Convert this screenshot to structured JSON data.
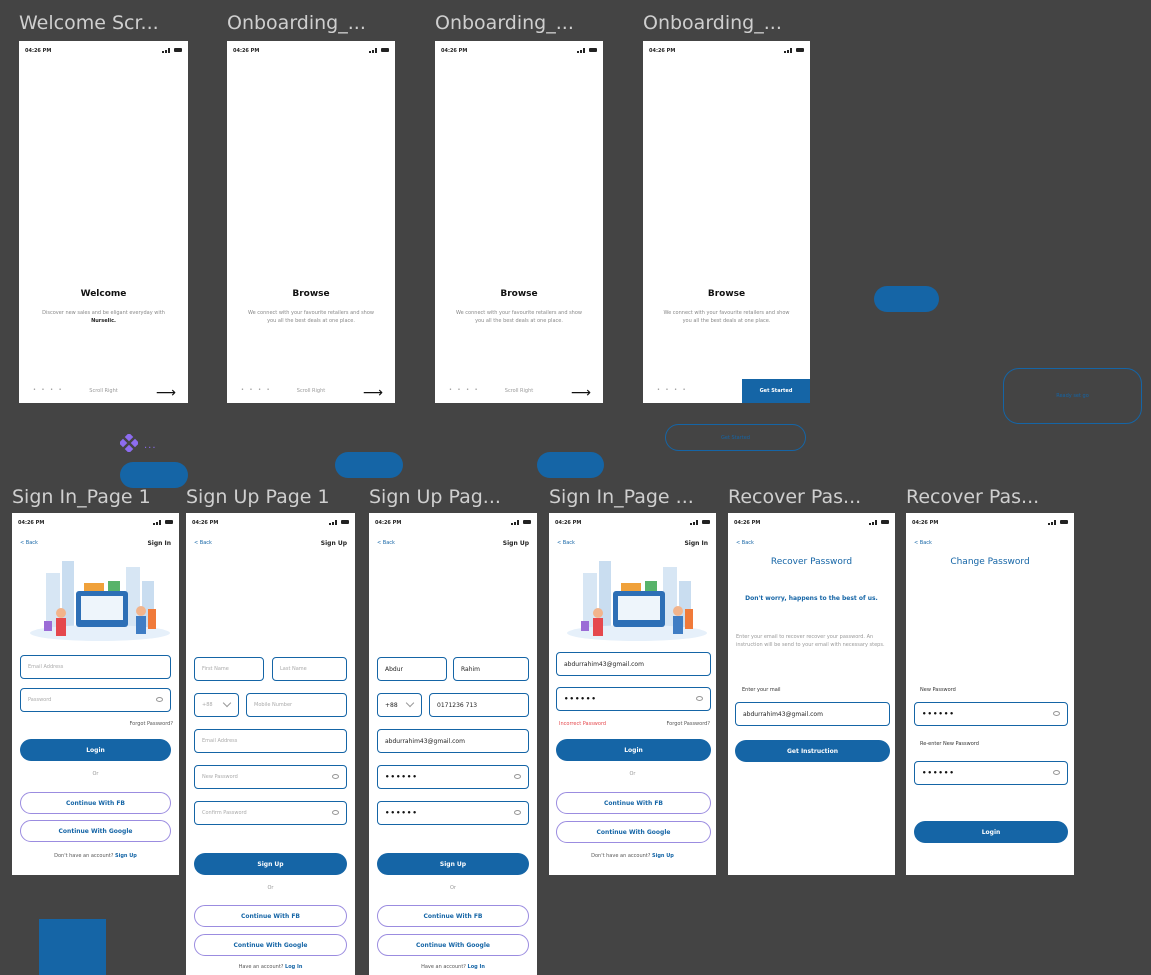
{
  "colors": {
    "canvas": "#444444",
    "primary": "#1565a6",
    "outline": "#9b8ce0",
    "component": "#8d6cf0"
  },
  "icons": {
    "signal": "signal-icon",
    "wifi": "wifi-icon",
    "battery": "battery-icon",
    "arrow": "arrow-right-icon",
    "eye": "eye-icon",
    "chevron": "chevron-down-icon",
    "component": "component-icon"
  },
  "frames": {
    "welcome": {
      "title": "Welcome Scr...",
      "time": "04:26 PM",
      "heading": "Welcome",
      "desc_a": "Discover new sales and be eligant everyday with ",
      "desc_brand": "Nurselic.",
      "dots": "• • • •",
      "scroll": "Scroll Right",
      "arrow": "⟶"
    },
    "onb1": {
      "title": "Onboarding_...",
      "time": "04:26 PM",
      "heading": "Browse",
      "desc": "We connect with your favourite retailers and show you all the best deals at one place.",
      "dots": "• • • •",
      "scroll": "Scroll Right",
      "arrow": "⟶"
    },
    "onb2": {
      "title": "Onboarding_...",
      "time": "04:26 PM",
      "heading": "Browse",
      "desc": "We connect with your favourite retailers and show you all the best deals at one place.",
      "dots": "• • • •",
      "scroll": "Scroll Right",
      "arrow": "⟶"
    },
    "onb3": {
      "title": "Onboarding_...",
      "time": "04:26 PM",
      "heading": "Browse",
      "desc": "We connect with your favourite retailers and show you all the best deals at one place.",
      "dots": "• • • •",
      "get_started": "Get Started"
    },
    "signin1": {
      "title": "Sign In_Page 1",
      "time": "04:26 PM",
      "back": "< Back",
      "header": "Sign In",
      "email_ph": "Email Address",
      "password_ph": "Password",
      "forgot": "Forgot Password?",
      "login": "Login",
      "or": "Or",
      "fb": "Continue With FB",
      "google": "Continue With Google",
      "footer_a": "Don't have an account? ",
      "footer_b": "Sign Up"
    },
    "signup1": {
      "title": "Sign Up Page 1",
      "time": "04:26 PM",
      "back": "< Back",
      "header": "Sign Up",
      "first_ph": "First Name",
      "last_ph": "Last Name",
      "code": "+88",
      "mobile_ph": "Mobile Number",
      "email_ph": "Email Address",
      "newpw_ph": "New Password",
      "confirm_ph": "Confirm Password",
      "signup": "Sign Up",
      "or": "Or",
      "fb": "Continue With FB",
      "google": "Continue With Google",
      "footer_a": "Have an account? ",
      "footer_b": "Log In"
    },
    "signup2": {
      "title": "Sign Up Pag...",
      "time": "04:26 PM",
      "back": "< Back",
      "header": "Sign Up",
      "first": "Abdur",
      "last": "Rahim",
      "code": "+88",
      "mobile": "0171236 713",
      "email": "abdurrahim43@gmail.com",
      "pw": "••••••",
      "confirm": "••••••",
      "signup": "Sign Up",
      "or": "Or",
      "fb": "Continue With FB",
      "google": "Continue With Google",
      "footer_a": "Have an account? ",
      "footer_b": "Log In"
    },
    "signin2": {
      "title": "Sign In_Page ...",
      "time": "04:26 PM",
      "back": "< Back",
      "header": "Sign In",
      "email": "abdurrahim43@gmail.com",
      "pw": "••••••",
      "error": "Incorrect Password",
      "forgot": "Forgot Password?",
      "login": "Login",
      "or": "Or",
      "fb": "Continue With FB",
      "google": "Continue With Google",
      "footer_a": "Don't have an account? ",
      "footer_b": "Sign Up"
    },
    "recover1": {
      "title": "Recover Pas...",
      "time": "04:26 PM",
      "back": "< Back",
      "heading": "Recover Password",
      "sub": "Don't worry, happens to the best of us.",
      "desc": "Enter your email to recover recover your password. An instruction will be send to your email with necessary steps.",
      "label": "Enter your mail",
      "email": "abdurrahim43@gmail.com",
      "button": "Get Instruction"
    },
    "recover2": {
      "title": "Recover Pas...",
      "time": "04:26 PM",
      "back": "< Back",
      "heading": "Change Password",
      "label1": "New Password",
      "pw1": "••••••",
      "label2": "Re-enter New Password",
      "pw2": "••••••",
      "button": "Login"
    }
  },
  "loose": {
    "ghost_get_started": "Get Started",
    "ghost_ready": "Ready set go",
    "comp_dots": "..."
  }
}
